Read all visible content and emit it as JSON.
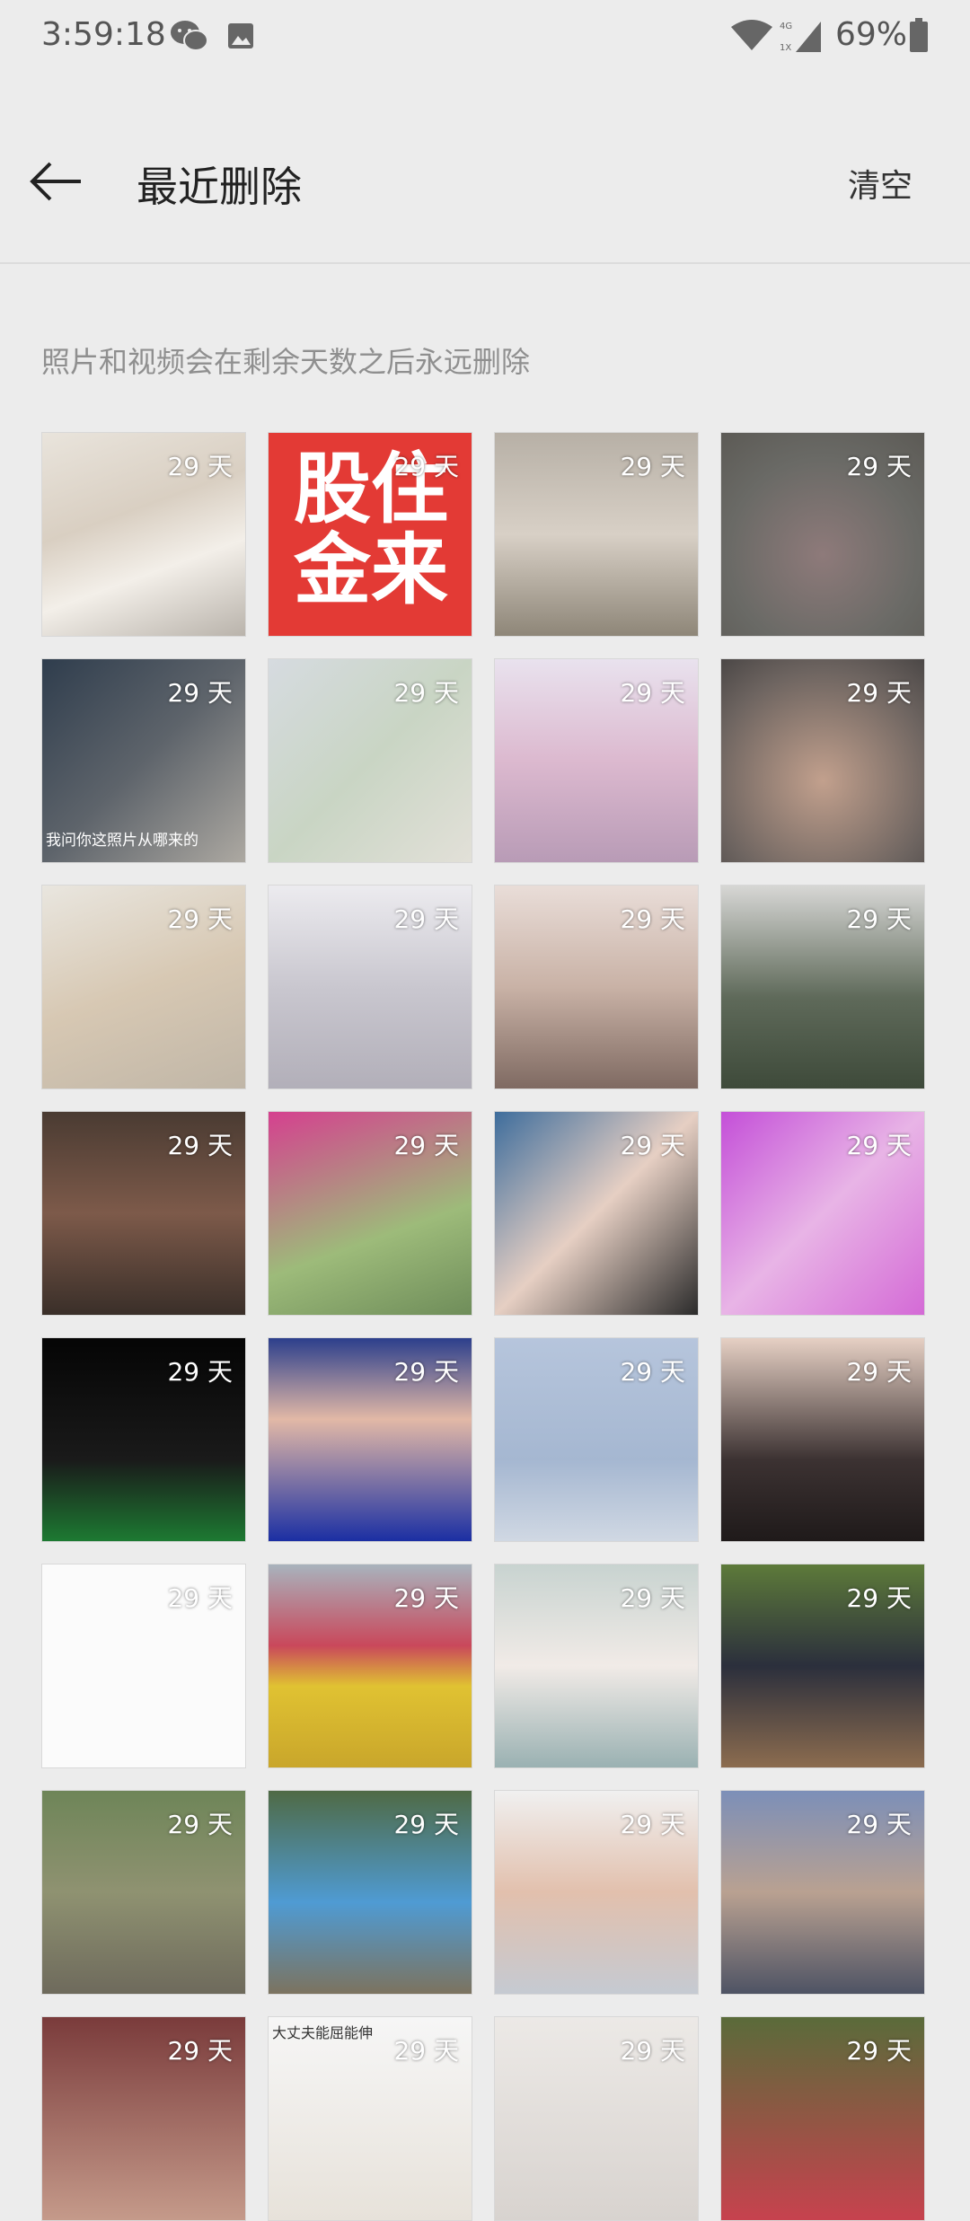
{
  "status_bar": {
    "time": "3:59:18",
    "battery": "69%",
    "network_top": "4G",
    "network_bottom": "1X",
    "icons": [
      "wechat-icon",
      "gallery-icon",
      "wifi-icon",
      "signal-icon",
      "battery-icon"
    ]
  },
  "header": {
    "title": "最近删除",
    "clear_label": "清空"
  },
  "notice": "照片和视频会在剩余天数之后永远删除",
  "photos": [
    {
      "days": "29 天"
    },
    {
      "days": "29 天",
      "text": "股住金来"
    },
    {
      "days": "29 天"
    },
    {
      "days": "29 天"
    },
    {
      "days": "29 天",
      "caption": "我问你这照片从哪来的"
    },
    {
      "days": "29 天"
    },
    {
      "days": "29 天"
    },
    {
      "days": "29 天"
    },
    {
      "days": "29 天"
    },
    {
      "days": "29 天"
    },
    {
      "days": "29 天"
    },
    {
      "days": "29 天"
    },
    {
      "days": "29 天"
    },
    {
      "days": "29 天"
    },
    {
      "days": "29 天"
    },
    {
      "days": "29 天"
    },
    {
      "days": "29 天"
    },
    {
      "days": "29 天"
    },
    {
      "days": "29 天"
    },
    {
      "days": "29 天"
    },
    {
      "days": "29 天"
    },
    {
      "days": "29 天"
    },
    {
      "days": "29 天"
    },
    {
      "days": "29 天"
    },
    {
      "days": "29 天"
    },
    {
      "days": "29 天"
    },
    {
      "days": "29 天"
    },
    {
      "days": "29 天"
    },
    {
      "days": "29 天"
    },
    {
      "days": "29 天",
      "caption": "大丈夫能屈能伸"
    },
    {
      "days": "29 天"
    },
    {
      "days": "29 天"
    }
  ]
}
